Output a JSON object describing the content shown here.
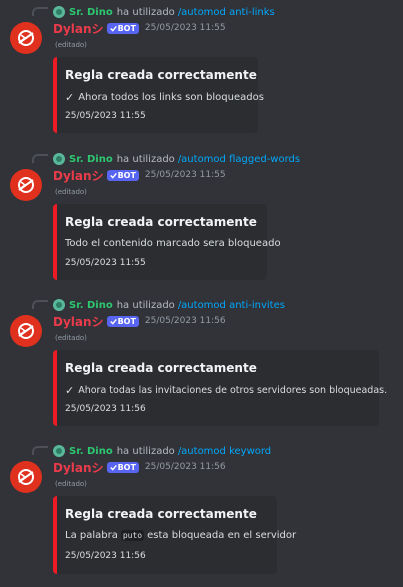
{
  "messages": [
    {
      "reply_user": "Sr. Dino",
      "reply_verb": "ha utilizado",
      "reply_command": "/automod anti-links",
      "author": "Dylan",
      "author_suffix": "シ",
      "badge": "BOT",
      "timestamp": "25/05/2023 11:55",
      "edited": "(editado)",
      "embed_title": "Regla creada correctamente",
      "embed_desc": "Ahora todos los links son bloqueados",
      "embed_footer": "25/05/2023 11:55"
    },
    {
      "reply_user": "Sr. Dino",
      "reply_verb": "ha utilizado",
      "reply_command": "/automod flagged-words",
      "author": "Dylan",
      "author_suffix": "シ",
      "badge": "BOT",
      "timestamp": "25/05/2023 11:55",
      "edited": "(editado)",
      "embed_title": "Regla creada correctamente",
      "embed_desc": "Todo el contenido marcado sera bloqueado",
      "embed_footer": "25/05/2023 11:55"
    },
    {
      "reply_user": "Sr. Dino",
      "reply_verb": "ha utilizado",
      "reply_command": "/automod anti-invites",
      "author": "Dylan",
      "author_suffix": "シ",
      "badge": "BOT",
      "timestamp": "25/05/2023 11:56",
      "edited": "(editado)",
      "embed_title": "Regla creada correctamente",
      "embed_desc": "Ahora todas las invitaciones de otros servidores son bloqueadas.",
      "embed_footer": "25/05/2023 11:56"
    },
    {
      "reply_user": "Sr. Dino",
      "reply_verb": "ha utilizado",
      "reply_command": "/automod keyword",
      "author": "Dylan",
      "author_suffix": "シ",
      "badge": "BOT",
      "timestamp": "25/05/2023 11:56",
      "edited": "(editado)",
      "embed_title": "Regla creada correctamente",
      "embed_desc_pre": "La palabra",
      "embed_desc_code": "puto",
      "embed_desc_post": "esta bloqueada en el servidor",
      "embed_footer": "25/05/2023 11:56"
    }
  ],
  "colors": {
    "background": "#313338",
    "embed_bg": "#2b2d31",
    "embed_accent": "#ed1c24",
    "author": "#ea3b4b",
    "reply_user": "#2dc770",
    "command": "#00a8fc",
    "badge": "#5865f2"
  },
  "icons": {
    "avatar": "red-no-symbol-avatar",
    "check": "check-icon",
    "verified": "verified-check-icon"
  }
}
